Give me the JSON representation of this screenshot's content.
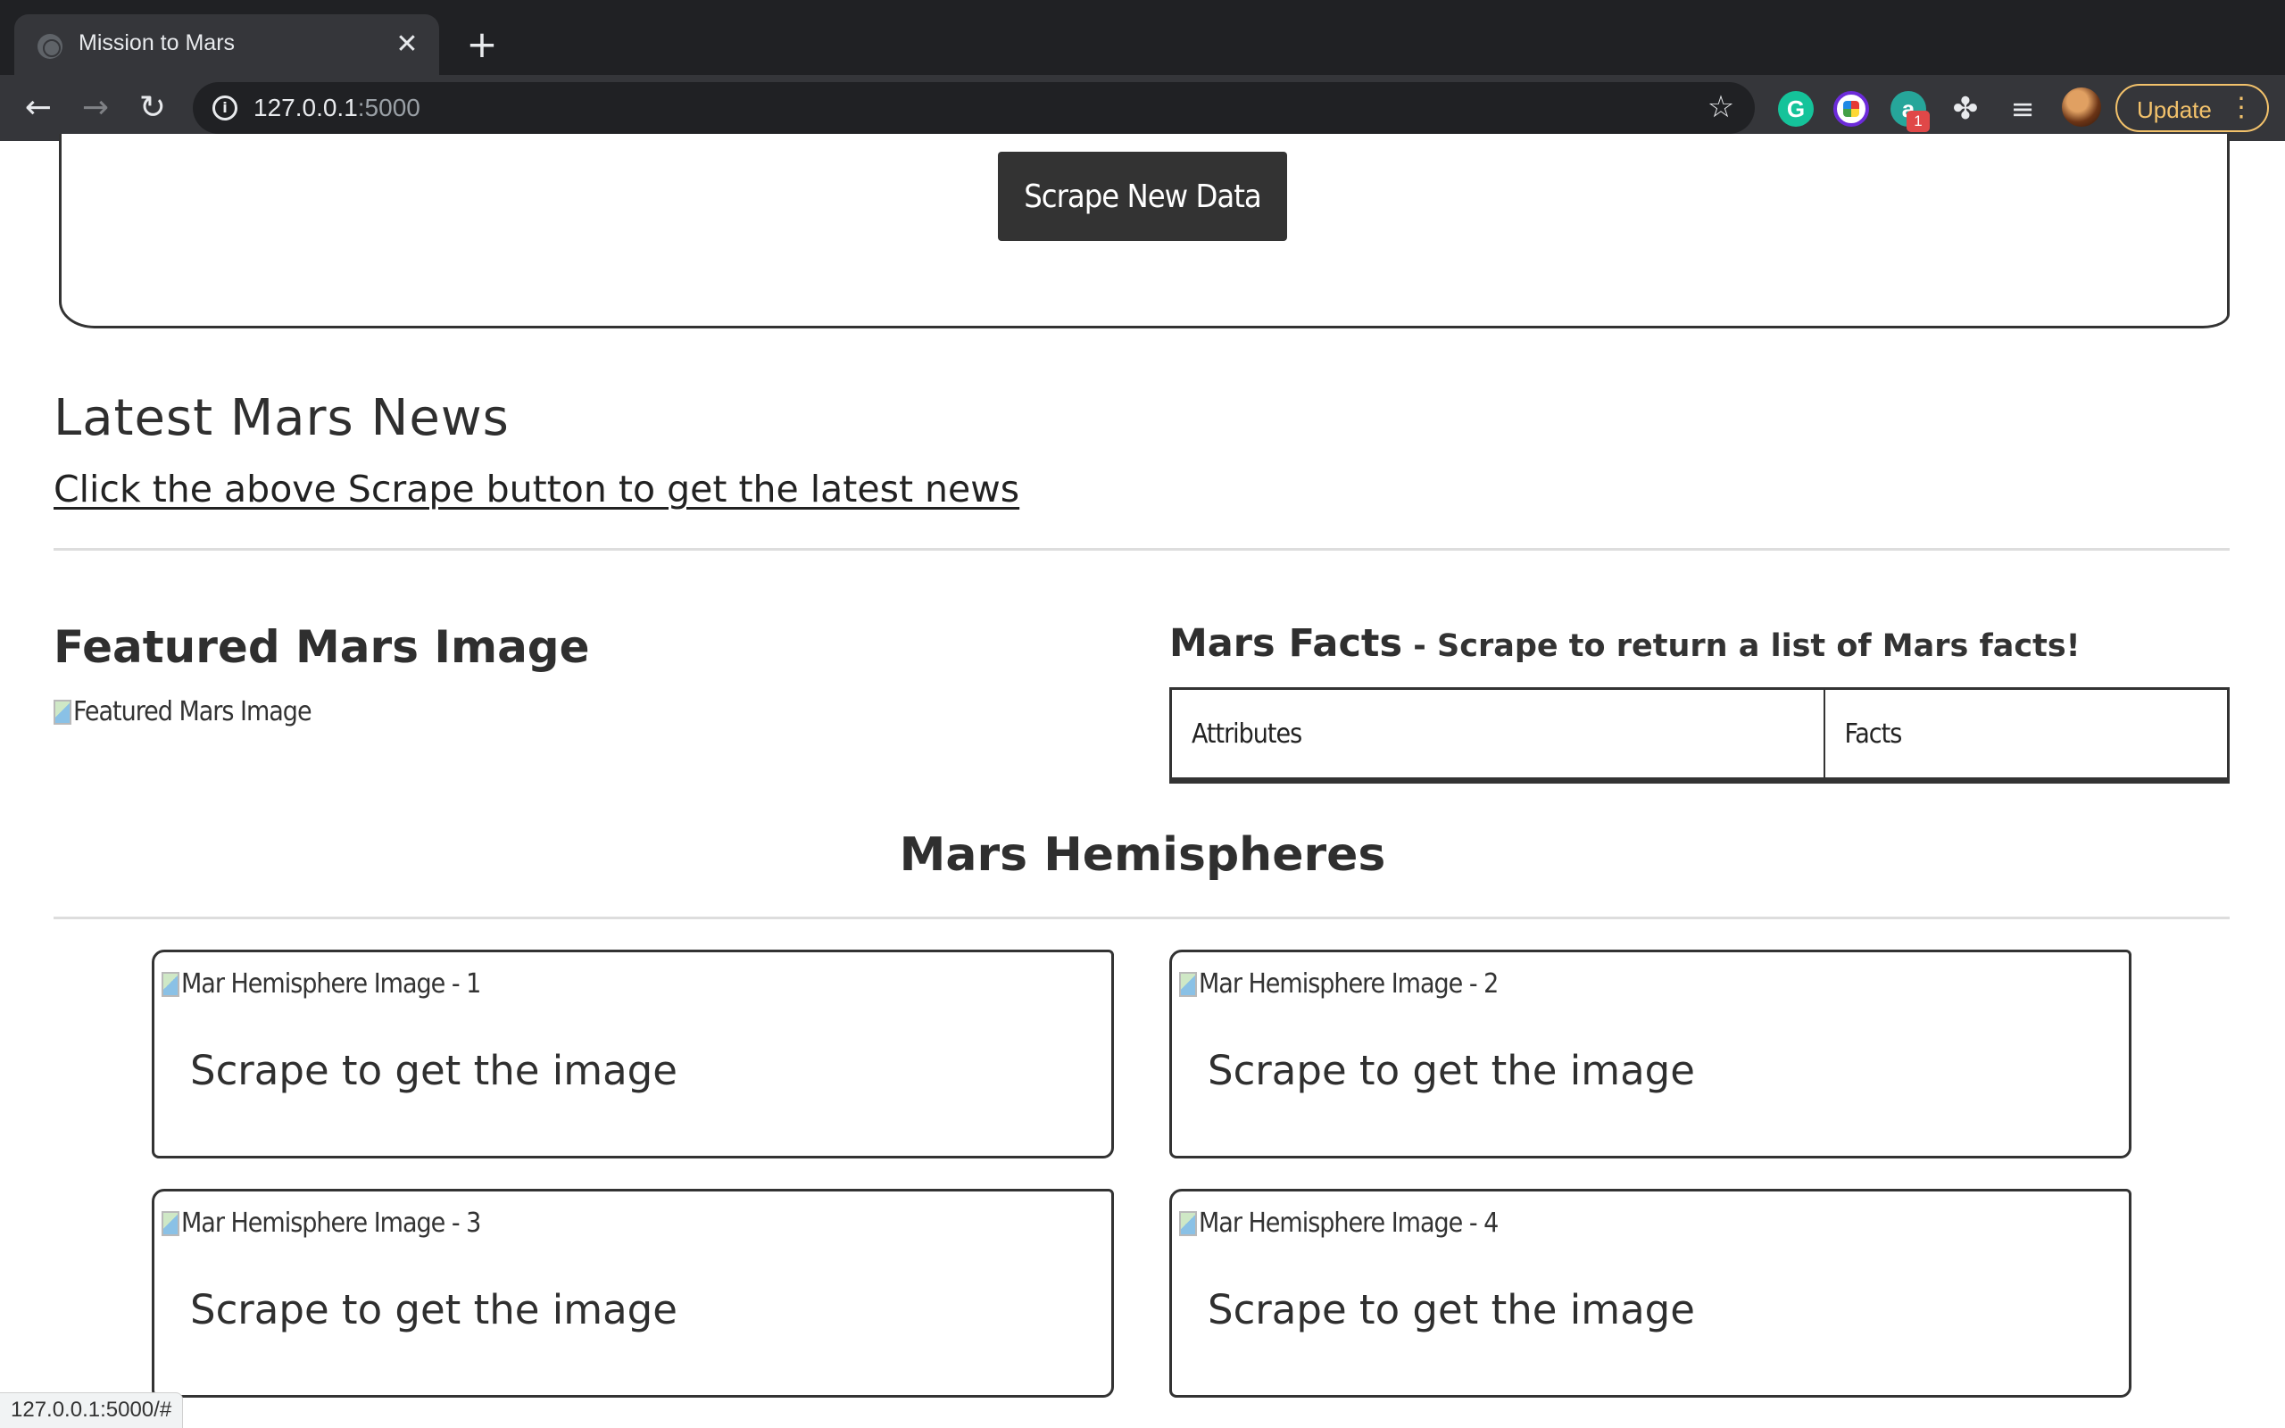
{
  "browser": {
    "tab_title": "Mission to Mars",
    "tab_close": "✕",
    "new_tab": "+",
    "nav": {
      "back": "←",
      "forward": "→",
      "reload": "↻"
    },
    "url_host": "127.0.0.1",
    "url_port": ":5000",
    "info_icon": "i",
    "bookmark_icon": "☆",
    "extensions": {
      "grammarly": "G",
      "counter": "a",
      "counter_badge": "1",
      "puzzle": "✤",
      "media": "≡"
    },
    "update_label": "Update",
    "menu_icon": "⋮",
    "status_url": "127.0.0.1:5000/#"
  },
  "header": {
    "scrape_button": "Scrape New Data"
  },
  "news": {
    "heading": "Latest Mars News",
    "link_text": "Click the above Scrape button to get the latest news"
  },
  "featured": {
    "heading": "Featured Mars Image",
    "image_alt": "Featured Mars Image"
  },
  "facts": {
    "heading": "Mars Facts",
    "subheading": " - Scrape to return a list of Mars facts!",
    "columns": [
      "Attributes",
      "Facts"
    ]
  },
  "hemispheres": {
    "heading": "Mars Hemispheres",
    "items": [
      {
        "alt": "Mar Hemisphere Image - 1",
        "caption": "Scrape to get the image"
      },
      {
        "alt": "Mar Hemisphere Image - 2",
        "caption": "Scrape to get the image"
      },
      {
        "alt": "Mar Hemisphere Image - 3",
        "caption": "Scrape to get the image"
      },
      {
        "alt": "Mar Hemisphere Image - 4",
        "caption": "Scrape to get the image"
      }
    ]
  },
  "colors": {
    "chrome_dark": "#202124",
    "chrome_toolbar": "#35363a",
    "update_accent": "#f3c26b",
    "button_dark": "#333333",
    "divider": "#dddddd"
  }
}
